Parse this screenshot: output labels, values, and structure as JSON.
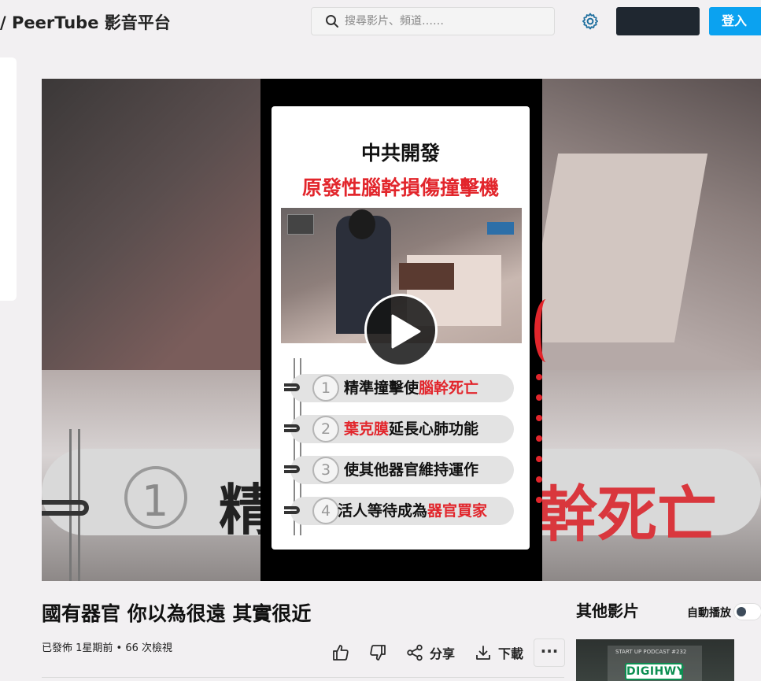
{
  "header": {
    "brand": "/ PeerTube 影音平台",
    "search_placeholder": "搜尋影片、頻道……",
    "login_label": "登入"
  },
  "video": {
    "overlay_title": "中共開發",
    "overlay_subtitle": "原發性腦幹損傷撞擊機",
    "overlay_items": [
      {
        "num": "1",
        "text_before": "精準撞擊使",
        "text_red": "腦幹死亡",
        "text_after": ""
      },
      {
        "num": "2",
        "text_before": "",
        "text_red": "葉克膜",
        "text_after": "延長心肺功能"
      },
      {
        "num": "3",
        "text_before": "使其他器官維持運作",
        "text_red": "",
        "text_after": ""
      },
      {
        "num": "4",
        "text_before": "活人等待成為",
        "text_red": "器官買家",
        "text_after": ""
      }
    ],
    "bg_num": "1",
    "bg_glyph": "精",
    "bg_red_text": "幹死亡"
  },
  "details": {
    "title": "國有器官 你以為很遠 其實很近",
    "meta": "已發佈 1星期前 • 66 次檢視",
    "share_label": "分享",
    "download_label": "下載",
    "more_label": "···"
  },
  "sidebar": {
    "title": "其他影片",
    "autoplay_label": "自動播放",
    "autoplay_on": false,
    "thumb_caption": "START UP PODCAST #232",
    "thumb_logo": "DIGIHWY"
  },
  "colors": {
    "accent": "#0ba2f0",
    "dark_button": "#1f2730",
    "red": "#e2262c"
  }
}
